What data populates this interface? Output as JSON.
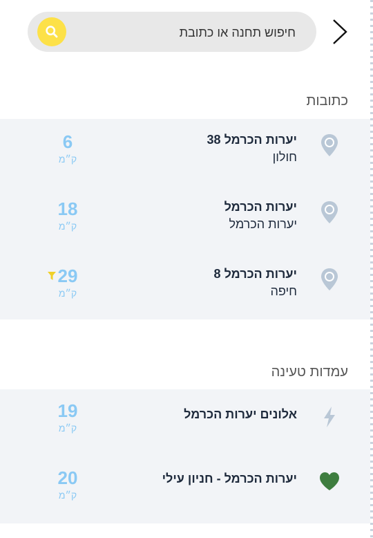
{
  "search": {
    "placeholder": "חיפוש תחנה או כתובת"
  },
  "sections": {
    "addresses_title": "כתובות",
    "stations_title": "עמדות טעינה"
  },
  "addresses": [
    {
      "title": "יערות הכרמל 38",
      "subtitle": "חולון",
      "distance": "6",
      "unit": "ק״מ"
    },
    {
      "title": "יערות הכרמל",
      "subtitle": "יערות הכרמל",
      "distance": "18",
      "unit": "ק״מ"
    },
    {
      "title": "יערות הכרמל 8",
      "subtitle": "חיפה",
      "distance": "29",
      "unit": "ק״מ",
      "filter_icon": "filter-icon"
    }
  ],
  "stations": [
    {
      "title": "אלונים יערות הכרמל",
      "distance": "19",
      "unit": "ק״מ",
      "icon": "lightning-icon"
    },
    {
      "title": "יערות הכרמל - חניון עילי",
      "distance": "20",
      "unit": "ק״מ",
      "icon": "heart-icon"
    }
  ],
  "colors": {
    "accent_yellow": "#fde148",
    "distance_blue": "#8ac9f4",
    "pin_gray": "#b9c7d6",
    "heart_green": "#3e7d3f",
    "list_bg": "#f2f4f7"
  }
}
